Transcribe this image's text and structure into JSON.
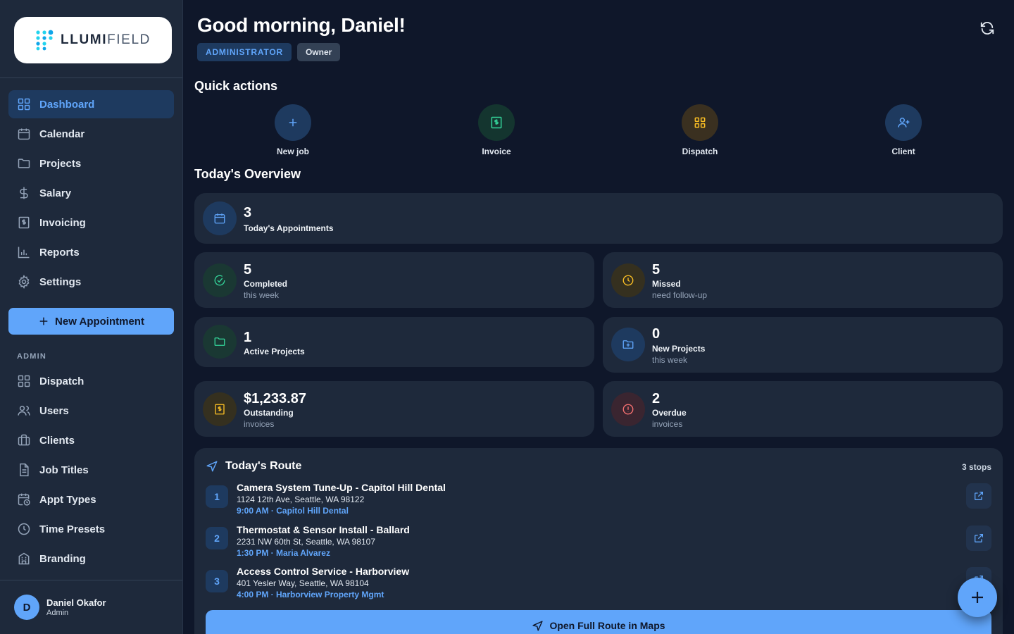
{
  "brand": {
    "logo_bold": "LLUMI",
    "logo_light": "FIELD"
  },
  "sidebar": {
    "items": [
      {
        "label": "Dashboard",
        "icon": "grid-icon",
        "active": true
      },
      {
        "label": "Calendar",
        "icon": "calendar-icon"
      },
      {
        "label": "Projects",
        "icon": "folder-icon"
      },
      {
        "label": "Salary",
        "icon": "dollar-icon"
      },
      {
        "label": "Invoicing",
        "icon": "receipt-icon"
      },
      {
        "label": "Reports",
        "icon": "bar-chart-icon"
      },
      {
        "label": "Settings",
        "icon": "gear-icon"
      }
    ],
    "new_appointment": "New Appointment",
    "admin_label": "ADMIN",
    "admin_items": [
      {
        "label": "Dispatch",
        "icon": "grid-icon"
      },
      {
        "label": "Users",
        "icon": "users-icon"
      },
      {
        "label": "Clients",
        "icon": "briefcase-icon"
      },
      {
        "label": "Job Titles",
        "icon": "document-icon"
      },
      {
        "label": "Appt Types",
        "icon": "calendar-clock-icon"
      },
      {
        "label": "Time Presets",
        "icon": "clock-icon"
      },
      {
        "label": "Branding",
        "icon": "building-icon"
      }
    ],
    "user": {
      "initial": "D",
      "name": "Daniel Okafor",
      "role": "Admin"
    }
  },
  "header": {
    "greeting": "Good morning, Daniel!",
    "role_badge": "ADMINISTRATOR",
    "owner_badge": "Owner"
  },
  "quick_actions": {
    "title": "Quick actions",
    "items": [
      {
        "label": "New job",
        "icon": "plus-icon"
      },
      {
        "label": "Invoice",
        "icon": "receipt-icon"
      },
      {
        "label": "Dispatch",
        "icon": "grid-icon"
      },
      {
        "label": "Client",
        "icon": "user-plus-icon"
      }
    ]
  },
  "overview": {
    "title": "Today's Overview",
    "appointments": {
      "value": "3",
      "label": "Today's Appointments"
    },
    "completed": {
      "value": "5",
      "label": "Completed",
      "sub": "this week"
    },
    "missed": {
      "value": "5",
      "label": "Missed",
      "sub": "need follow-up"
    },
    "active_projects": {
      "value": "1",
      "label": "Active Projects"
    },
    "new_projects": {
      "value": "0",
      "label": "New Projects",
      "sub": "this week"
    },
    "outstanding": {
      "value": "$1,233.87",
      "label": "Outstanding",
      "sub": "invoices"
    },
    "overdue": {
      "value": "2",
      "label": "Overdue",
      "sub": "invoices"
    }
  },
  "route": {
    "title": "Today's Route",
    "stops_count": "3 stops",
    "stops": [
      {
        "num": "1",
        "name": "Camera System Tune-Up - Capitol Hill Dental",
        "address": "1124 12th Ave, Seattle, WA 98122",
        "meta": "9:00 AM · Capitol Hill Dental"
      },
      {
        "num": "2",
        "name": "Thermostat & Sensor Install - Ballard",
        "address": "2231 NW 60th St, Seattle, WA 98107",
        "meta": "1:30 PM · Maria Alvarez"
      },
      {
        "num": "3",
        "name": "Access Control Service - Harborview",
        "address": "401 Yesler Way, Seattle, WA 98104",
        "meta": "4:00 PM · Harborview Property Mgmt"
      }
    ],
    "open_button": "Open Full Route in Maps"
  },
  "colors": {
    "background": "#0f172a",
    "panel": "#1e293b",
    "accent": "#60a5fa",
    "success": "#34d399",
    "warning": "#fbbf24",
    "danger": "#f87171"
  }
}
